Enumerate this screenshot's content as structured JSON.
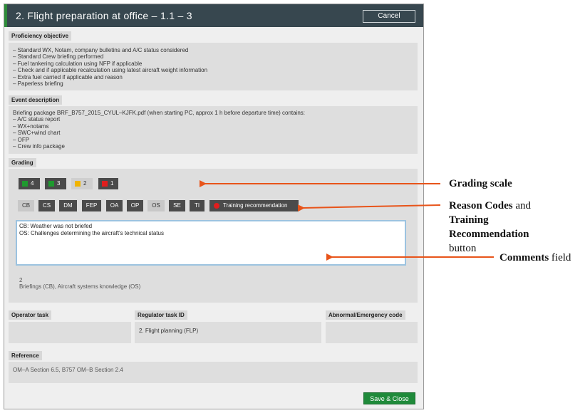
{
  "dialog": {
    "title": "2. Flight preparation at office – 1.1 – 3",
    "cancel_label": "Cancel",
    "save_label": "Save & Close"
  },
  "proficiency": {
    "label": "Proficiency objective",
    "lines": [
      "– Standard WX, Notam, company bulletins and A/C status considered",
      "– Standard Crew briefing performed",
      "– Fuel tankering calculation using NFP if applicable",
      "– Check and if applicable recalculation using latest aircraft weight information",
      "– Extra fuel carried if applicable and reason",
      "– Paperless briefing"
    ]
  },
  "event": {
    "label": "Event description",
    "lines": [
      "Briefing package BRF_B757_2015_CYUL–KJFK.pdf (when starting PC, approx 1 h before departure time) contains:",
      "– A/C status report",
      "– WX+notams",
      "– SWC+wind chart",
      "– OFP",
      "– Crew info package"
    ]
  },
  "grading": {
    "label": "Grading",
    "scale": [
      {
        "label": "4",
        "color": "#1e9a2e"
      },
      {
        "label": "3",
        "color": "#1e9a2e"
      },
      {
        "label": "2",
        "color": "#f0b400"
      },
      {
        "label": "1",
        "color": "#e11d1d"
      }
    ],
    "codes": [
      "CB",
      "CS",
      "DM",
      "FEP",
      "OA",
      "OP",
      "OS",
      "SE",
      "TI"
    ],
    "training_label": "Training recommendation",
    "comments": [
      "CB: Weather was not briefed",
      "OS: Challenges determining the aircraft's technical status"
    ],
    "summary_grade": "2",
    "summary_codes": "Briefings (CB), Aircraft systems knowledge (OS)"
  },
  "operator_task": {
    "label": "Operator task",
    "value": ""
  },
  "regulator_task": {
    "label": "Regulator task ID",
    "value": "2. Flight planning (FLP)"
  },
  "abnormal": {
    "label": "Abnormal/Emergency code",
    "value": ""
  },
  "reference": {
    "label": "Reference",
    "value": "OM–A Section 6.5, B757 OM–B Section 2.4"
  },
  "annotations": {
    "grading_scale": "Grading scale",
    "reason_codes_bold": "Reason Codes",
    "reason_codes_and": " and",
    "training_bold_1": "Training",
    "training_bold_2": "Recommendation",
    "button_word": "button",
    "comments_bold": "Comments",
    "comments_field": " field"
  },
  "colors": {
    "accent": "#2e8b3a",
    "titlebar": "#37474f",
    "arrow": "#e8541a"
  }
}
